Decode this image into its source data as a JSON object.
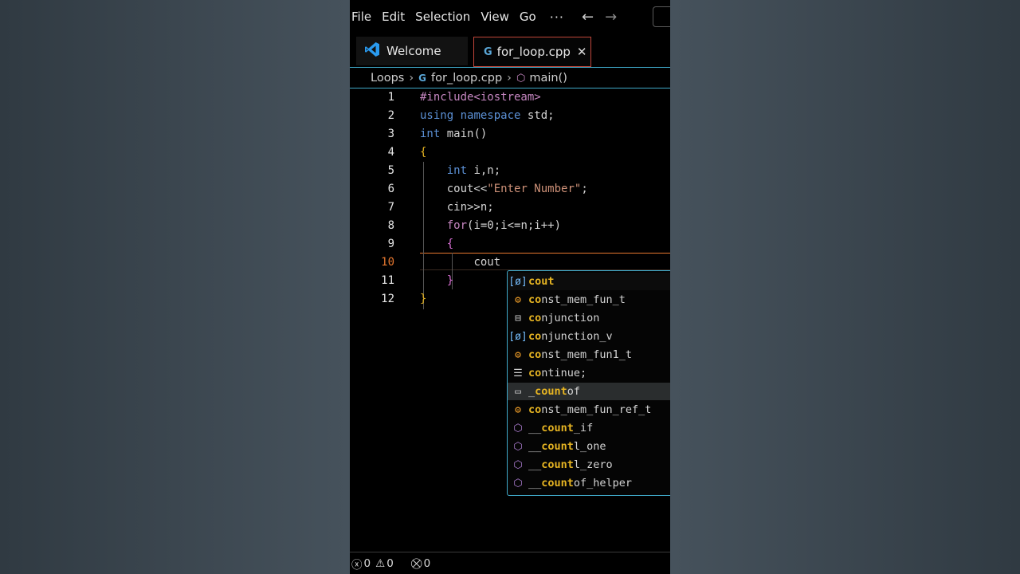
{
  "menubar": {
    "items": [
      "File",
      "Edit",
      "Selection",
      "View",
      "Go"
    ],
    "more": "···",
    "back_icon": "←",
    "forward_icon": "→"
  },
  "tabs": [
    {
      "label": "Welcome",
      "icon": "vscode-logo-icon",
      "active": false
    },
    {
      "label": "for_loop.cpp",
      "icon": "cpp-file-icon",
      "active": true,
      "close": "✕"
    }
  ],
  "breadcrumb": {
    "folder": "Loops",
    "file": "for_loop.cpp",
    "symbol": "main()"
  },
  "editor": {
    "current_line": 10,
    "lines": [
      {
        "n": "1"
      },
      {
        "n": "2"
      },
      {
        "n": "3"
      },
      {
        "n": "4"
      },
      {
        "n": "5"
      },
      {
        "n": "6"
      },
      {
        "n": "7"
      },
      {
        "n": "8"
      },
      {
        "n": "9"
      },
      {
        "n": "10"
      },
      {
        "n": "11"
      },
      {
        "n": "12"
      }
    ],
    "code": {
      "l1": "#include<iostream>",
      "l2_kw1": "using",
      "l2_kw2": "namespace",
      "l2_rest": " std;",
      "l3_kw": "int",
      "l3_rest": " main()",
      "l4": "{",
      "l5_kw": "int",
      "l5_rest": " i,n;",
      "l6_a": "cout<<",
      "l6_str": "\"Enter Number\"",
      "l6_b": ";",
      "l7": "cin>>n;",
      "l8_kw": "for",
      "l8_rest": "(i=0;i<=n;i++)",
      "l9": "{",
      "l10": "cout",
      "l11": "}",
      "l12": "}"
    }
  },
  "suggestions": [
    {
      "icon": "variable-icon",
      "pre": "",
      "match": "cout",
      "post": ""
    },
    {
      "icon": "class-icon",
      "pre": "",
      "match": "co",
      "post": "nst_mem_fun_t"
    },
    {
      "icon": "namespace-icon",
      "pre": "",
      "match": "co",
      "post": "njunction"
    },
    {
      "icon": "variable-icon",
      "pre": "",
      "match": "co",
      "post": "njunction_v"
    },
    {
      "icon": "class-icon",
      "pre": "",
      "match": "co",
      "post": "nst_mem_fun1_t"
    },
    {
      "icon": "keyword-icon",
      "pre": "",
      "match": "co",
      "post": "ntinue;"
    },
    {
      "icon": "snippet-icon",
      "pre": "_",
      "match": "count",
      "post": "of"
    },
    {
      "icon": "class-icon",
      "pre": "",
      "match": "co",
      "post": "nst_mem_fun_ref_t"
    },
    {
      "icon": "cube-icon",
      "pre": "__",
      "match": "count",
      "post": "_if"
    },
    {
      "icon": "cube-icon",
      "pre": "__",
      "match": "count",
      "post": "l_one"
    },
    {
      "icon": "cube-icon",
      "pre": "__",
      "match": "count",
      "post": "l_zero"
    },
    {
      "icon": "cube-icon",
      "pre": "__",
      "match": "count",
      "post": "of_helper"
    }
  ],
  "status": {
    "errors": "0",
    "warnings": "0",
    "ports": "0"
  }
}
